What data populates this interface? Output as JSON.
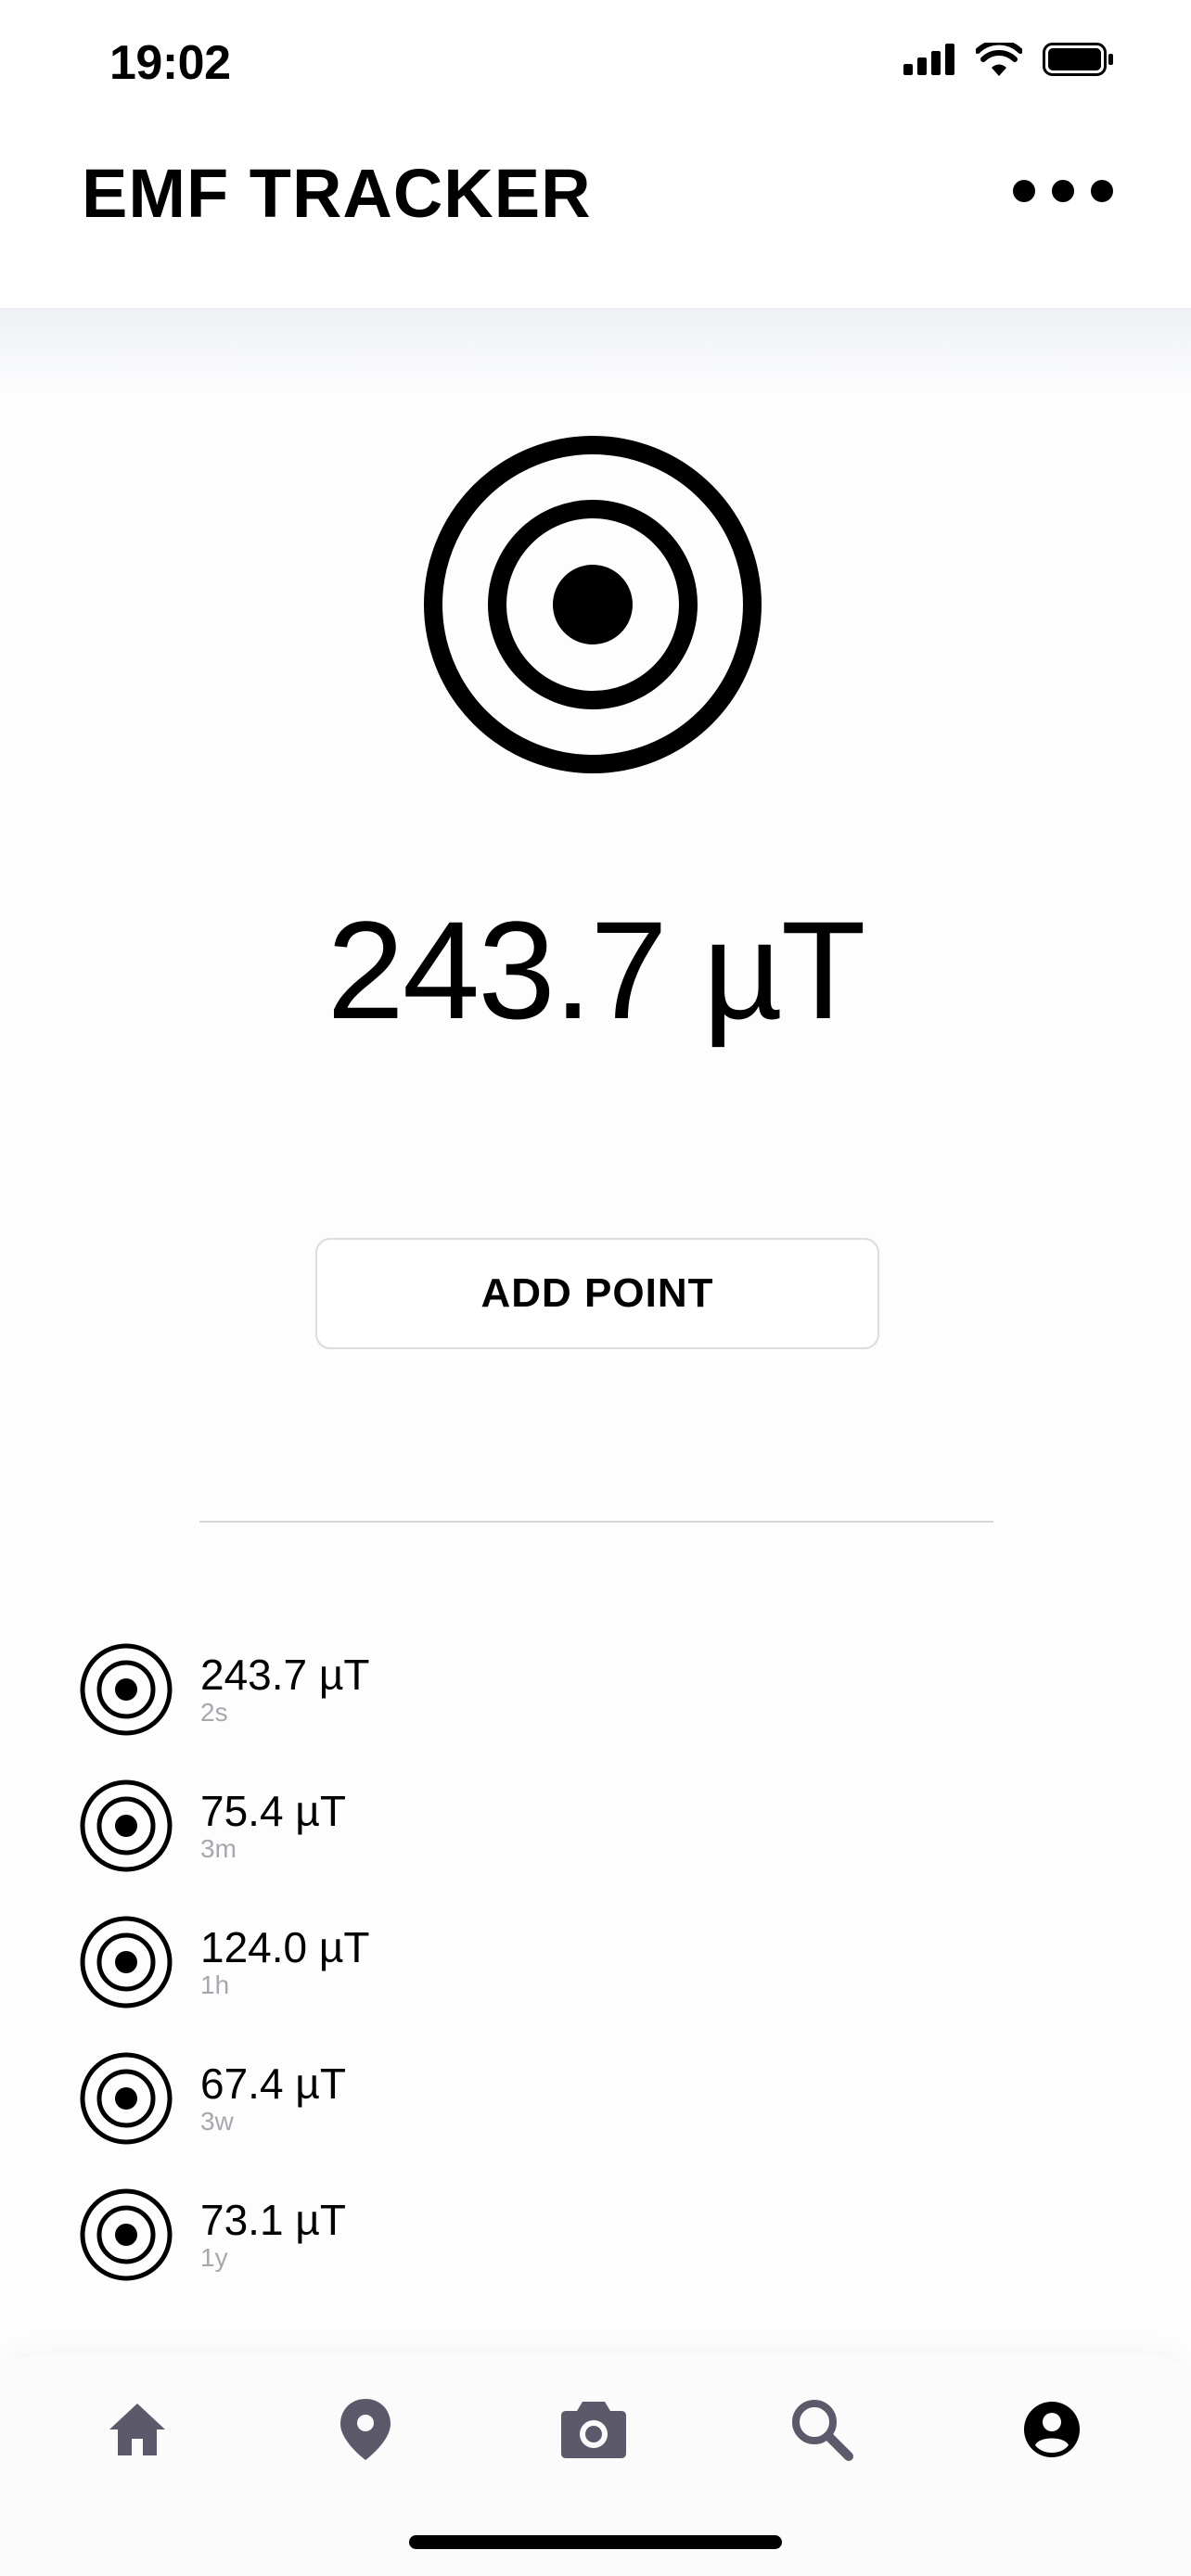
{
  "status_bar": {
    "time": "19:02"
  },
  "header": {
    "title": "EMF TRACKER",
    "menu_icon": "more-horizontal-icon"
  },
  "reading": {
    "value": "243.7 µT",
    "icon": "target-icon"
  },
  "actions": {
    "add_point_label": "ADD POINT"
  },
  "history": [
    {
      "value": "243.7 µT",
      "age": "2s"
    },
    {
      "value": "75.4 µT",
      "age": "3m"
    },
    {
      "value": "124.0 µT",
      "age": "1h"
    },
    {
      "value": "67.4 µT",
      "age": "3w"
    },
    {
      "value": "73.1 µT",
      "age": "1y"
    }
  ],
  "nav": [
    {
      "icon": "home-icon"
    },
    {
      "icon": "map-pin-icon"
    },
    {
      "icon": "camera-icon"
    },
    {
      "icon": "search-icon"
    },
    {
      "icon": "account-icon"
    }
  ],
  "colors": {
    "nav_icon": "#5c5a6a",
    "text": "#000000",
    "muted": "#a7a7ad"
  }
}
